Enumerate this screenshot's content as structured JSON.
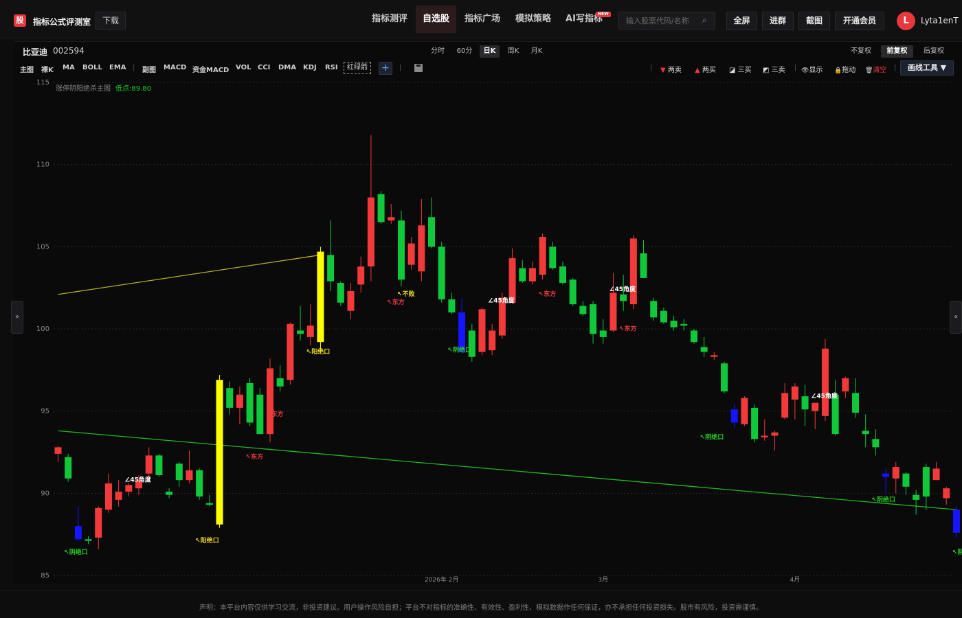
{
  "app": {
    "logo_glyph": "股",
    "title": "指标公式评测室",
    "download": "下载"
  },
  "nav": [
    {
      "label": "指标测评",
      "active": false
    },
    {
      "label": "自选股",
      "active": true
    },
    {
      "label": "指标广场",
      "active": false
    },
    {
      "label": "模拟策略",
      "active": false
    },
    {
      "label": "AI写指标",
      "active": false
    }
  ],
  "new_badge": "NEW",
  "search": {
    "placeholder": "输入股票代码/名称",
    "icon": "search-icon"
  },
  "top_buttons": [
    "全屏",
    "进群",
    "截图",
    "开通会员"
  ],
  "user": {
    "initial": "L",
    "name": "Lyta1enT"
  },
  "stock": {
    "name": "比亚迪",
    "code": "002594"
  },
  "periods": [
    {
      "label": "分时",
      "active": false
    },
    {
      "label": "60分",
      "active": false
    },
    {
      "label": "日K",
      "active": true
    },
    {
      "label": "周K",
      "active": false
    },
    {
      "label": "月K",
      "active": false
    }
  ],
  "adjust": [
    {
      "label": "不复权",
      "active": false
    },
    {
      "label": "前复权",
      "active": true
    },
    {
      "label": "后复权",
      "active": false
    }
  ],
  "indicators_main": [
    "主图",
    "裸K",
    "MA",
    "BOLL",
    "EMA"
  ],
  "indicators_sub": [
    "副图",
    "MACD",
    "资金MACD",
    "VOL",
    "CCI",
    "DMA",
    "KDJ",
    "RSI"
  ],
  "indicator_box": "红绿箭",
  "plus": "+",
  "draw_tools": [
    {
      "glyph": "▼",
      "label": "两卖",
      "color": "#e8383d"
    },
    {
      "glyph": "▲",
      "label": "两买",
      "color": "#e8383d"
    },
    {
      "glyph": "◪",
      "label": "三买",
      "color": "#cfcfcf"
    },
    {
      "glyph": "◩",
      "label": "三卖",
      "color": "#cfcfcf"
    },
    {
      "glyph": "👁",
      "label": "显示",
      "color": "#cfcfcf"
    },
    {
      "glyph": "🔒",
      "label": "拖动",
      "color": "#f0c040"
    },
    {
      "glyph": "🗑",
      "label": "清空",
      "color": "#e8383d"
    }
  ],
  "draw_menu": "画线工具 ▼",
  "side_left": "»",
  "side_right": "«",
  "chart_data": {
    "type": "candlestick",
    "legend_name": "涨停阴阳绝杀主图",
    "legend_low": "低点:89.80",
    "ylim": [
      85,
      115
    ],
    "yticks": [
      85,
      90,
      95,
      100,
      105,
      110,
      115
    ],
    "xticks": [
      {
        "label": "2026年 2月",
        "index": 38
      },
      {
        "label": "3月",
        "index": 54
      },
      {
        "label": "4月",
        "index": 73
      }
    ],
    "candles": [
      {
        "o": 92.4,
        "h": 92.9,
        "l": 91.9,
        "c": 92.8
      },
      {
        "o": 92.2,
        "h": 92.4,
        "l": 90.7,
        "c": 90.9
      },
      {
        "o": 88.0,
        "h": 89.2,
        "l": 87.1,
        "c": 87.2,
        "special": "blue"
      },
      {
        "o": 87.2,
        "h": 87.4,
        "l": 86.9,
        "c": 87.1
      },
      {
        "o": 87.3,
        "h": 89.2,
        "l": 86.6,
        "c": 89.1
      },
      {
        "o": 89.0,
        "h": 91.2,
        "l": 88.8,
        "c": 90.6
      },
      {
        "o": 89.6,
        "h": 90.8,
        "l": 89.2,
        "c": 90.1
      },
      {
        "o": 90.1,
        "h": 90.6,
        "l": 89.8,
        "c": 90.5
      },
      {
        "o": 90.3,
        "h": 91.1,
        "l": 89.9,
        "c": 90.8
      },
      {
        "o": 91.2,
        "h": 92.8,
        "l": 90.6,
        "c": 92.3
      },
      {
        "o": 92.3,
        "h": 92.4,
        "l": 91.0,
        "c": 91.1
      },
      {
        "o": 90.1,
        "h": 90.3,
        "l": 89.7,
        "c": 89.9
      },
      {
        "o": 91.8,
        "h": 91.9,
        "l": 90.4,
        "c": 90.8
      },
      {
        "o": 90.8,
        "h": 92.6,
        "l": 90.6,
        "c": 91.4
      },
      {
        "o": 91.4,
        "h": 91.5,
        "l": 89.6,
        "c": 89.8
      },
      {
        "o": 89.4,
        "h": 89.9,
        "l": 89.2,
        "c": 89.3
      },
      {
        "o": 88.1,
        "h": 97.2,
        "l": 87.9,
        "c": 96.9,
        "special": "yellow"
      },
      {
        "o": 96.4,
        "h": 96.8,
        "l": 94.8,
        "c": 95.2
      },
      {
        "o": 95.2,
        "h": 96.5,
        "l": 94.2,
        "c": 96.0
      },
      {
        "o": 96.7,
        "h": 97.0,
        "l": 94.1,
        "c": 94.3
      },
      {
        "o": 96.0,
        "h": 96.4,
        "l": 93.6,
        "c": 93.6
      },
      {
        "o": 93.6,
        "h": 98.2,
        "l": 93.1,
        "c": 97.6
      },
      {
        "o": 97.0,
        "h": 97.8,
        "l": 96.2,
        "c": 96.5
      },
      {
        "o": 96.9,
        "h": 100.4,
        "l": 96.6,
        "c": 100.3
      },
      {
        "o": 99.9,
        "h": 101.4,
        "l": 99.3,
        "c": 99.7
      },
      {
        "o": 99.5,
        "h": 101.5,
        "l": 99.0,
        "c": 100.2
      },
      {
        "o": 99.2,
        "h": 105.0,
        "l": 98.6,
        "c": 104.7,
        "special": "yellow"
      },
      {
        "o": 104.5,
        "h": 106.6,
        "l": 102.3,
        "c": 102.9
      },
      {
        "o": 102.8,
        "h": 102.9,
        "l": 101.4,
        "c": 101.6
      },
      {
        "o": 101.1,
        "h": 102.8,
        "l": 100.6,
        "c": 102.3
      },
      {
        "o": 102.7,
        "h": 104.4,
        "l": 102.2,
        "c": 103.8
      },
      {
        "o": 103.8,
        "h": 111.8,
        "l": 102.9,
        "c": 108.0
      },
      {
        "o": 108.2,
        "h": 108.4,
        "l": 106.4,
        "c": 106.5
      },
      {
        "o": 106.6,
        "h": 107.6,
        "l": 106.4,
        "c": 106.8
      },
      {
        "o": 106.6,
        "h": 107.2,
        "l": 102.6,
        "c": 103.0
      },
      {
        "o": 103.9,
        "h": 105.6,
        "l": 103.6,
        "c": 105.2
      },
      {
        "o": 103.5,
        "h": 107.9,
        "l": 102.9,
        "c": 106.3
      },
      {
        "o": 106.8,
        "h": 108.0,
        "l": 104.9,
        "c": 105.0
      },
      {
        "o": 105.0,
        "h": 105.3,
        "l": 101.6,
        "c": 101.8
      },
      {
        "o": 101.8,
        "h": 102.2,
        "l": 100.9,
        "c": 101.0
      },
      {
        "o": 101.0,
        "h": 101.9,
        "l": 98.5,
        "c": 98.6,
        "special": "blue"
      },
      {
        "o": 99.9,
        "h": 100.3,
        "l": 98.0,
        "c": 98.3
      },
      {
        "o": 98.6,
        "h": 101.3,
        "l": 98.4,
        "c": 101.2
      },
      {
        "o": 98.7,
        "h": 100.3,
        "l": 98.4,
        "c": 99.9
      },
      {
        "o": 99.6,
        "h": 102.2,
        "l": 99.4,
        "c": 101.9
      },
      {
        "o": 101.6,
        "h": 104.9,
        "l": 101.5,
        "c": 104.3
      },
      {
        "o": 103.7,
        "h": 104.2,
        "l": 102.8,
        "c": 102.9
      },
      {
        "o": 102.9,
        "h": 104.1,
        "l": 102.7,
        "c": 103.7
      },
      {
        "o": 103.3,
        "h": 105.8,
        "l": 103.0,
        "c": 105.6
      },
      {
        "o": 105.0,
        "h": 105.3,
        "l": 103.6,
        "c": 103.7
      },
      {
        "o": 103.8,
        "h": 104.1,
        "l": 102.7,
        "c": 102.8
      },
      {
        "o": 103.0,
        "h": 103.1,
        "l": 101.4,
        "c": 101.5
      },
      {
        "o": 101.4,
        "h": 101.7,
        "l": 100.8,
        "c": 100.9
      },
      {
        "o": 101.5,
        "h": 101.7,
        "l": 99.1,
        "c": 99.7
      },
      {
        "o": 99.9,
        "h": 100.6,
        "l": 99.1,
        "c": 99.5
      },
      {
        "o": 99.9,
        "h": 103.4,
        "l": 99.8,
        "c": 102.2
      },
      {
        "o": 102.1,
        "h": 103.3,
        "l": 101.1,
        "c": 101.7
      },
      {
        "o": 101.5,
        "h": 105.7,
        "l": 101.2,
        "c": 105.5
      },
      {
        "o": 104.6,
        "h": 105.4,
        "l": 103.1,
        "c": 103.1
      },
      {
        "o": 101.7,
        "h": 101.9,
        "l": 100.5,
        "c": 100.7
      },
      {
        "o": 101.1,
        "h": 101.3,
        "l": 100.3,
        "c": 100.4
      },
      {
        "o": 100.5,
        "h": 100.8,
        "l": 99.9,
        "c": 100.1
      },
      {
        "o": 100.3,
        "h": 100.6,
        "l": 99.9,
        "c": 100.2
      },
      {
        "o": 99.9,
        "h": 100.0,
        "l": 99.1,
        "c": 99.2
      },
      {
        "o": 98.9,
        "h": 99.5,
        "l": 98.3,
        "c": 98.6
      },
      {
        "o": 98.3,
        "h": 98.6,
        "l": 98.1,
        "c": 98.4
      },
      {
        "o": 97.9,
        "h": 98.0,
        "l": 96.1,
        "c": 96.2
      },
      {
        "o": 95.1,
        "h": 95.4,
        "l": 94.0,
        "c": 94.3,
        "special": "blue"
      },
      {
        "o": 94.2,
        "h": 95.9,
        "l": 94.1,
        "c": 95.8
      },
      {
        "o": 95.2,
        "h": 95.4,
        "l": 93.1,
        "c": 93.3
      },
      {
        "o": 93.4,
        "h": 94.5,
        "l": 93.2,
        "c": 93.5
      },
      {
        "o": 93.5,
        "h": 93.8,
        "l": 92.6,
        "c": 93.7
      },
      {
        "o": 94.6,
        "h": 96.7,
        "l": 94.5,
        "c": 96.1
      },
      {
        "o": 95.7,
        "h": 96.7,
        "l": 94.5,
        "c": 96.5
      },
      {
        "o": 95.9,
        "h": 96.6,
        "l": 94.1,
        "c": 95.1
      },
      {
        "o": 95.0,
        "h": 95.5,
        "l": 93.9,
        "c": 95.5
      },
      {
        "o": 94.7,
        "h": 99.4,
        "l": 94.4,
        "c": 98.8
      },
      {
        "o": 96.0,
        "h": 96.9,
        "l": 93.5,
        "c": 93.6
      },
      {
        "o": 96.2,
        "h": 97.1,
        "l": 95.8,
        "c": 97.0
      },
      {
        "o": 96.1,
        "h": 97.0,
        "l": 94.6,
        "c": 94.9
      },
      {
        "o": 93.8,
        "h": 94.8,
        "l": 92.8,
        "c": 93.6
      },
      {
        "o": 93.3,
        "h": 93.9,
        "l": 92.3,
        "c": 92.8
      },
      {
        "o": 91.2,
        "h": 91.5,
        "l": 90.0,
        "c": 91.0,
        "special": "blue"
      },
      {
        "o": 90.9,
        "h": 91.9,
        "l": 90.0,
        "c": 91.6
      },
      {
        "o": 91.2,
        "h": 91.3,
        "l": 89.9,
        "c": 90.4
      },
      {
        "o": 89.9,
        "h": 90.2,
        "l": 88.7,
        "c": 89.6
      },
      {
        "o": 91.6,
        "h": 91.8,
        "l": 89.0,
        "c": 89.8
      },
      {
        "o": 90.8,
        "h": 91.9,
        "l": 90.8,
        "c": 91.5
      },
      {
        "o": 89.7,
        "h": 90.4,
        "l": 89.3,
        "c": 90.3
      },
      {
        "o": 89.0,
        "h": 89.2,
        "l": 87.3,
        "c": 87.6,
        "special": "blue"
      }
    ],
    "lines": [
      {
        "color": "#b8b020",
        "from": [
          0,
          102.1
        ],
        "to": [
          26,
          104.5
        ]
      },
      {
        "color": "#22b822",
        "from": [
          0,
          93.8
        ],
        "to": [
          89,
          89.0
        ]
      }
    ],
    "annotations": [
      {
        "text": "↖阴绝口",
        "color": "#22cc22",
        "index": 1,
        "y": 86.3
      },
      {
        "text": "∠45角度",
        "color": "#ffffff",
        "index": 7,
        "y": 90.7
      },
      {
        "text": "↖东方",
        "color": "#e8383d",
        "index": 19,
        "y": 92.1
      },
      {
        "text": "↖阳绝口",
        "color": "#e8d820",
        "index": 14,
        "y": 87.0
      },
      {
        "text": "↖东方",
        "color": "#e8383d",
        "index": 21,
        "y": 94.7
      },
      {
        "text": "↖阳绝口",
        "color": "#e8d820",
        "index": 25,
        "y": 98.5
      },
      {
        "text": "↖东方",
        "color": "#e8383d",
        "index": 33,
        "y": 101.5
      },
      {
        "text": "↖不败",
        "color": "#e8d820",
        "index": 34,
        "y": 102.0
      },
      {
        "text": "↖阴绝口",
        "color": "#22cc22",
        "index": 39,
        "y": 98.6
      },
      {
        "text": "∠45角度",
        "color": "#ffffff",
        "index": 43,
        "y": 101.6
      },
      {
        "text": "↖东方",
        "color": "#e8383d",
        "index": 48,
        "y": 102.0
      },
      {
        "text": "∠45角度",
        "color": "#ffffff",
        "index": 55,
        "y": 102.3
      },
      {
        "text": "↖东方",
        "color": "#e8383d",
        "index": 56,
        "y": 99.9
      },
      {
        "text": "↖阴绝口",
        "color": "#22cc22",
        "index": 64,
        "y": 93.3
      },
      {
        "text": "∠45角度",
        "color": "#ffffff",
        "index": 75,
        "y": 95.8
      },
      {
        "text": "↖阴绝口",
        "color": "#22cc22",
        "index": 81,
        "y": 89.5
      },
      {
        "text": "↖阴绝口",
        "color": "#22cc22",
        "index": 89,
        "y": 86.3
      }
    ]
  },
  "footer": "声明：本平台内容仅供学习交流，非投资建议。用户操作风险自担；平台不对指标的准确性、有效性、盈利性、模拟数据作任何保证，亦不承担任何投资损失。股市有风险，投资需谨慎。"
}
